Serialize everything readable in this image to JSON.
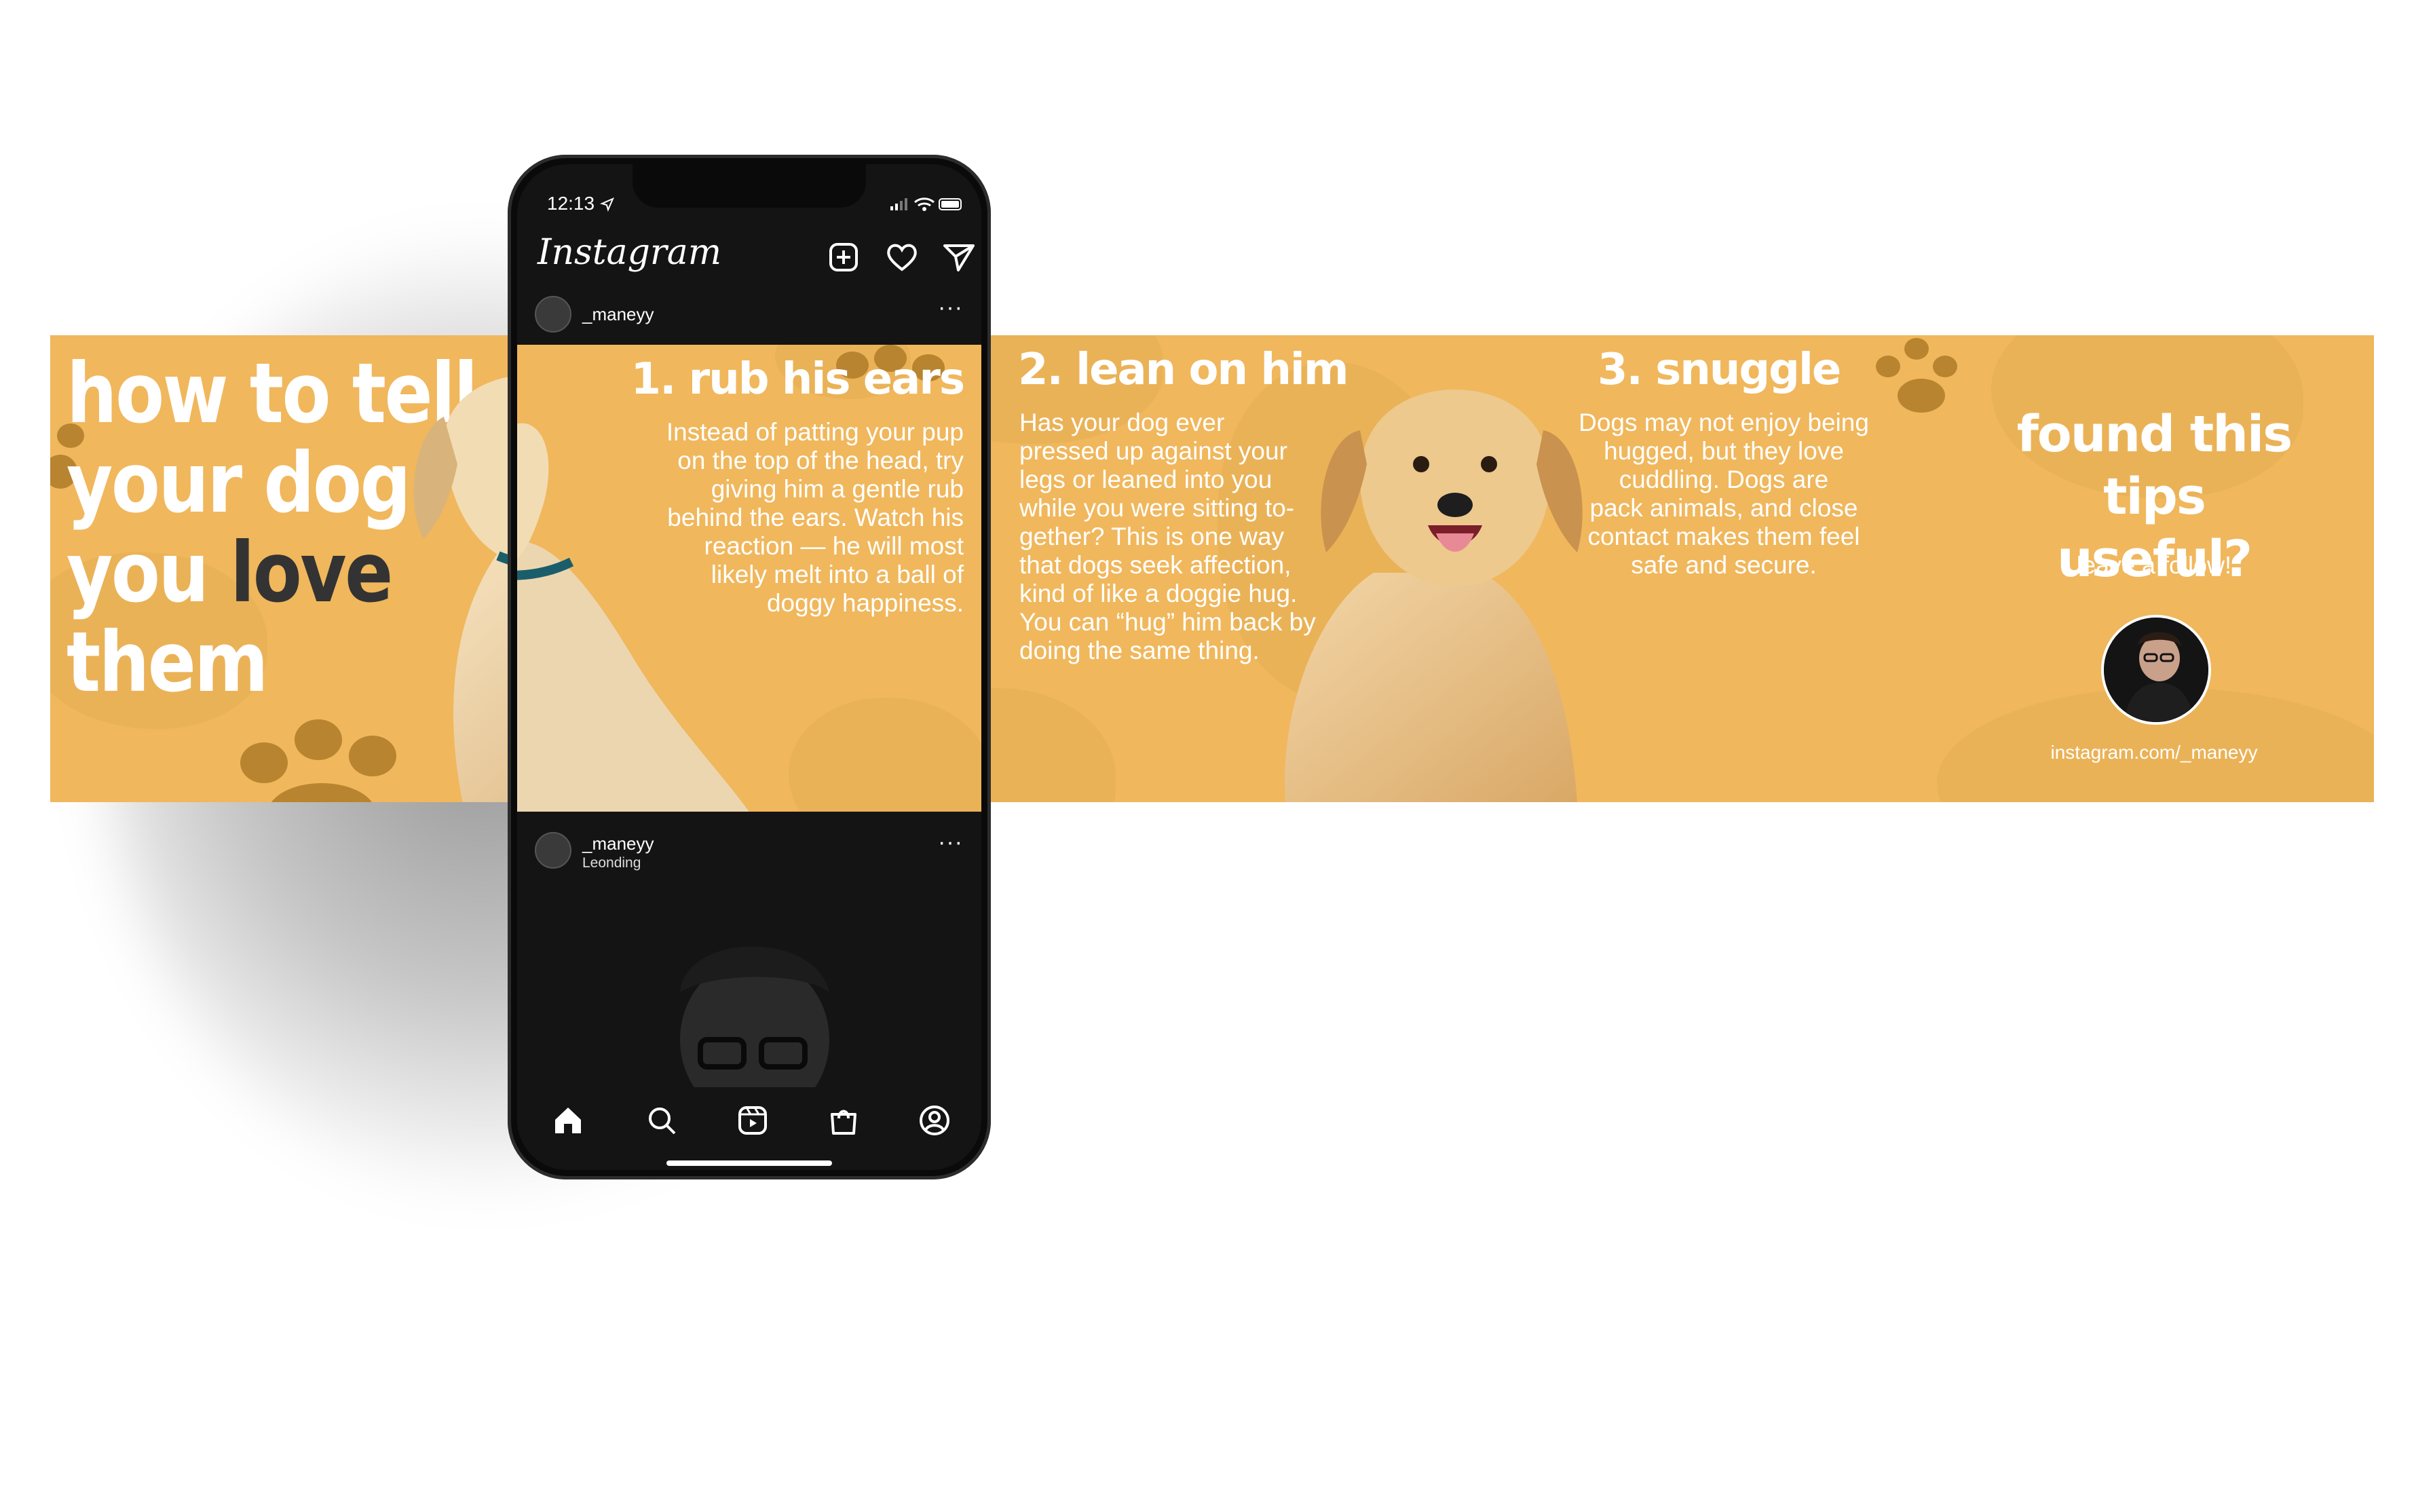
{
  "banner": {
    "slide1": {
      "title_line1": "how to tell",
      "title_line2": "your dog",
      "title_line3_pre": "you ",
      "title_line3_accent": "love",
      "title_line4": "them"
    },
    "slide2": {
      "heading": "1. rub his ears",
      "body": "Instead of patting your pup\non the top of the head, try\ngiving him a gentle rub\nbehind the ears. Watch his\nreaction — he will most\nlikely melt into a ball of\ndoggy happiness."
    },
    "slide3": {
      "heading": "2. lean on him",
      "body": "Has your dog ever\npressed up against your\nlegs or leaned into you\nwhile you were sitting to-\ngether? This is one way\nthat dogs seek affection,\nkind of like a doggie hug.\nYou can “hug” him back by\ndoing the same thing."
    },
    "slide4": {
      "heading": "3. snuggle",
      "body": "Dogs may not enjoy being\nhugged, but they love\ncuddling. Dogs are\npack animals, and close\ncontact makes them feel\nsafe and secure."
    },
    "slide5": {
      "heading_line1": "found this tips",
      "heading_line2": "useful?",
      "cta": "leave a follow!",
      "link": "instagram.com/_maneyy"
    }
  },
  "phone": {
    "status_time": "12:13",
    "app_title": "Instagram",
    "post1": {
      "username": "_maneyy"
    },
    "post2": {
      "username": "_maneyy",
      "location": "Leonding"
    }
  },
  "colors": {
    "accent": "#f0b75c",
    "paw": "#b8842f",
    "dark_text": "#333333",
    "phone_bg": "#141414"
  },
  "icons": [
    "add-post-icon",
    "heart-icon",
    "send-icon",
    "more-options-icon",
    "home-icon",
    "search-icon",
    "reels-icon",
    "shop-icon",
    "profile-icon",
    "location-arrow-icon",
    "signal-icon",
    "wifi-icon",
    "battery-icon"
  ]
}
